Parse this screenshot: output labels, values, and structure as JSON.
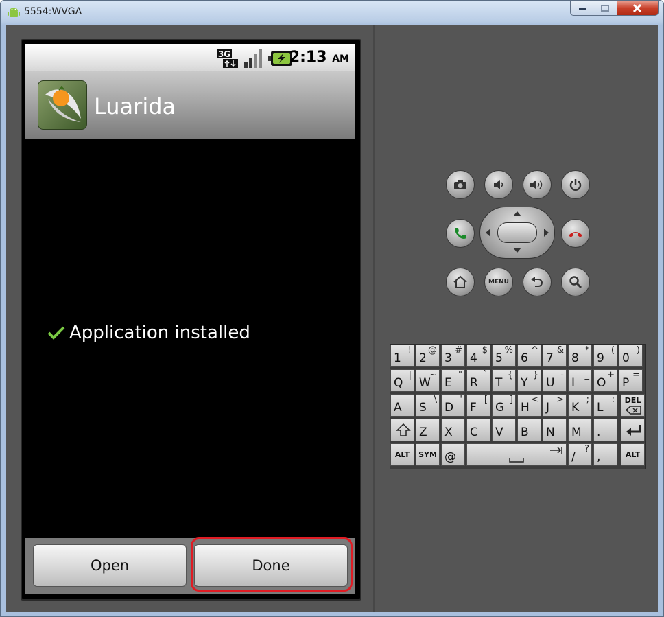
{
  "window": {
    "title": "5554:WVGA"
  },
  "status": {
    "time": "2:13",
    "ampm": "AM",
    "network": "3G"
  },
  "app": {
    "name": "Luarida"
  },
  "message": {
    "text": "Application installed"
  },
  "buttons": {
    "open": "Open",
    "done": "Done"
  },
  "controls": {
    "menu": "MENU"
  },
  "keyboard": {
    "row1": [
      [
        "1",
        "!"
      ],
      [
        "2",
        "@"
      ],
      [
        "3",
        "#"
      ],
      [
        "4",
        "$"
      ],
      [
        "5",
        "%"
      ],
      [
        "6",
        "^"
      ],
      [
        "7",
        "&"
      ],
      [
        "8",
        "*"
      ],
      [
        "9",
        "("
      ],
      [
        "0",
        ")"
      ]
    ],
    "row2": [
      [
        "Q",
        "|"
      ],
      [
        "W",
        "~"
      ],
      [
        "E",
        "\""
      ],
      [
        "R",
        "`"
      ],
      [
        "T",
        "{"
      ],
      [
        "Y",
        "}"
      ],
      [
        "U",
        "-"
      ],
      [
        "I",
        "_"
      ],
      [
        "O",
        "+"
      ],
      [
        "P",
        "="
      ]
    ],
    "row3": [
      [
        "A",
        ""
      ],
      [
        "S",
        "\\"
      ],
      [
        "D",
        "'"
      ],
      [
        "F",
        "["
      ],
      [
        "G",
        "]"
      ],
      [
        "H",
        "<"
      ],
      [
        "J",
        ">"
      ],
      [
        "K",
        ";"
      ],
      [
        "L",
        ":"
      ]
    ],
    "row4": [
      [
        "Z",
        ""
      ],
      [
        "X",
        ""
      ],
      [
        "C",
        ""
      ],
      [
        "V",
        ""
      ],
      [
        "B",
        ""
      ],
      [
        "N",
        ""
      ],
      [
        "M",
        ""
      ],
      [
        ".",
        ""
      ]
    ],
    "del": "DEL",
    "alt": "ALT",
    "sym": "SYM",
    "at": "@",
    "slash": "/",
    "question": "?",
    "comma": ","
  },
  "colors": {
    "highlight": "#e01c24",
    "check": "#7ac943"
  }
}
